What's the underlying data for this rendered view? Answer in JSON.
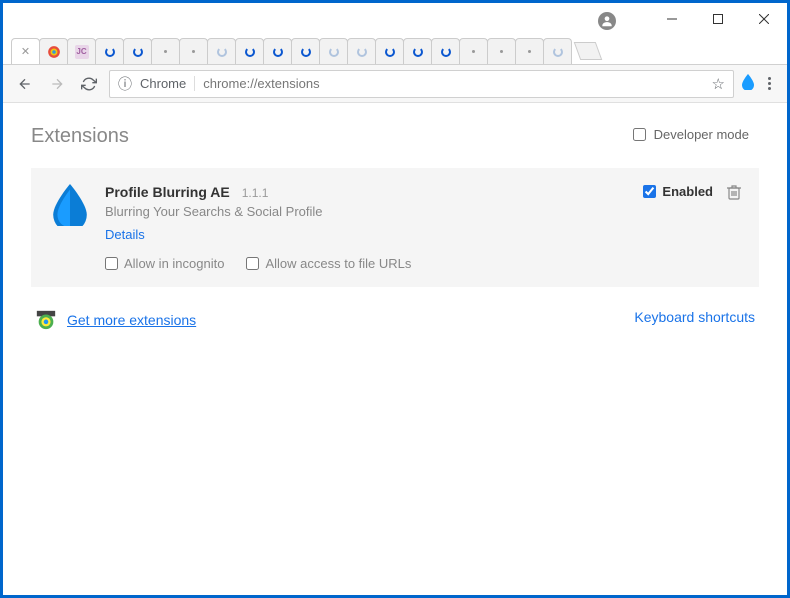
{
  "window": {
    "minimize": "−",
    "maximize": "☐",
    "close": "✕"
  },
  "omnibox": {
    "scheme": "Chrome",
    "url": "chrome://extensions"
  },
  "page": {
    "title": "Extensions",
    "developer_mode": "Developer mode"
  },
  "extension": {
    "name": "Profile Blurring AE",
    "version": "1.1.1",
    "description": "Blurring Your Searchs & Social Profile",
    "details": "Details",
    "allow_incognito": "Allow in incognito",
    "allow_file_urls": "Allow access to file URLs",
    "enabled_label": "Enabled",
    "enabled": true
  },
  "links": {
    "get_more": "Get more extensions",
    "keyboard_shortcuts": "Keyboard shortcuts"
  }
}
